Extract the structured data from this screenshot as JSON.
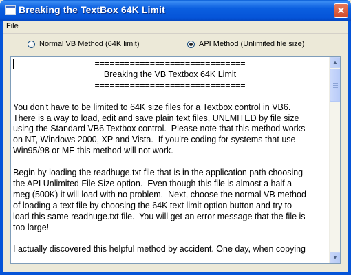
{
  "window": {
    "title": "Breaking the TextBox 64K Limit",
    "close_glyph": "✕",
    "title_color": "#0554d8",
    "face_color": "#ece9d8"
  },
  "menu": {
    "file": "File"
  },
  "options": {
    "normal": {
      "label": "Normal VB Method (64K limit)",
      "selected": false
    },
    "api": {
      "label": "API Method (Unlimited file size)",
      "selected": true
    }
  },
  "textbox": {
    "header_rule": "==============================",
    "header_title": "Breaking the VB Textbox 64K Limit",
    "body": "You don't have to be limited to 64K size files for a Textbox control in VB6.\nThere is a way to load, edit and save plain text files, UNLMITED by file size\nusing the Standard VB6 Textbox control.  Please note that this method works\non NT, Windows 2000, XP and Vista.  If you're coding for systems that use\nWin95/98 or ME this method will not work.\n\nBegin by loading the readhuge.txt file that is in the application path choosing\nthe API Unlimited File Size option.  Even though this file is almost a half a\nmeg (500K) it will load with no problem.  Next, choose the normal VB method\nof loading a text file by choosing the 64K text limit option button and try to\nload this same readhuge.txt file.  You will get an error message that the file is\ntoo large!\n\nI actually discovered this helpful method by accident. One day, when copying"
  },
  "icons": {
    "app": "app-window-icon",
    "close": "close-icon",
    "scroll_up": "scroll-up-arrow-icon",
    "scroll_down": "scroll-down-arrow-icon"
  }
}
